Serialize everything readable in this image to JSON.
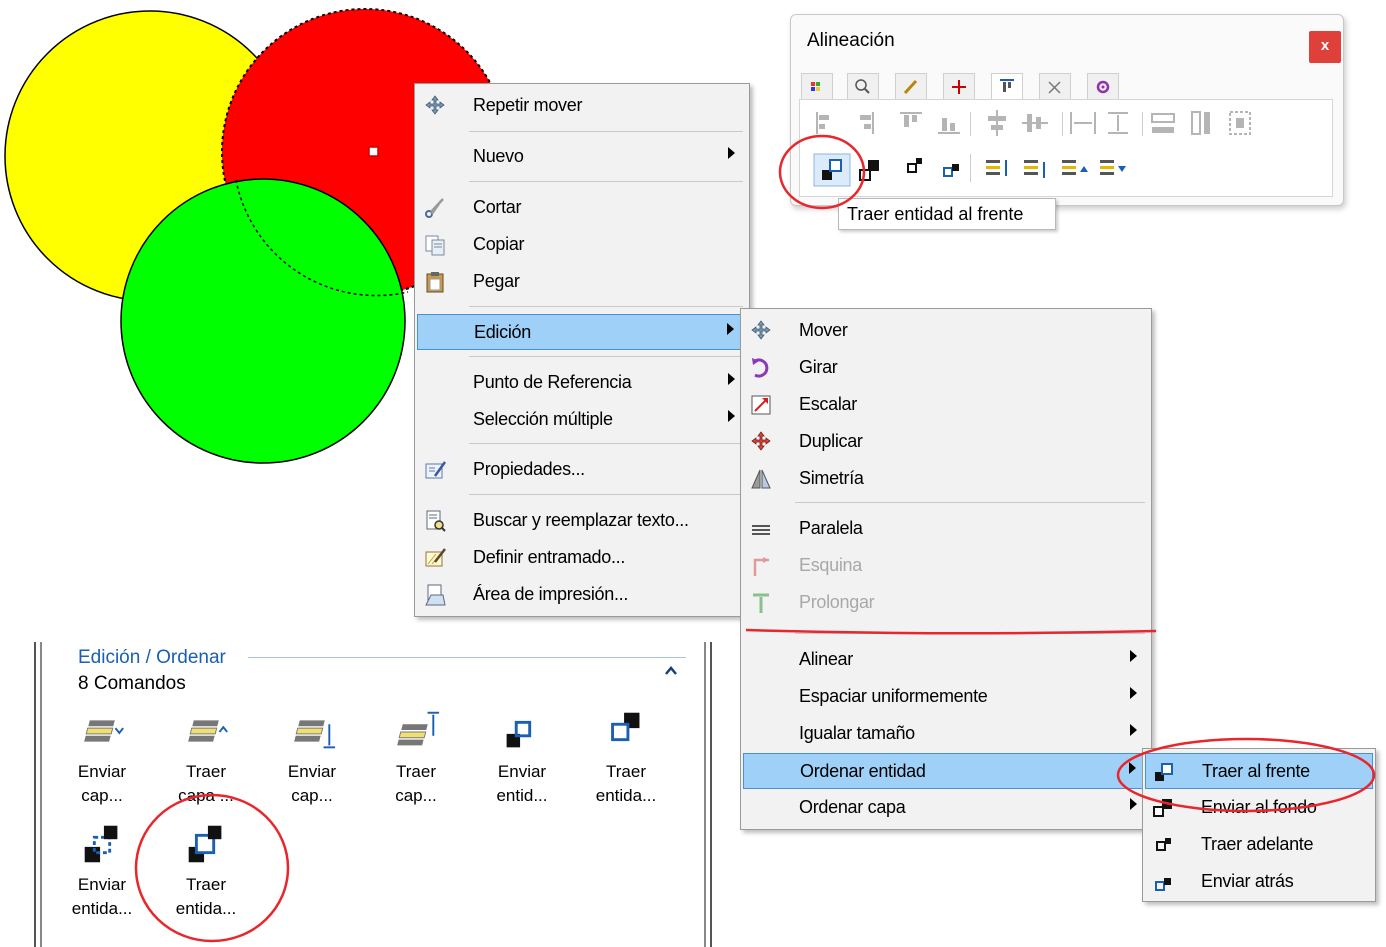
{
  "context_menu": {
    "items": [
      {
        "label": "Repetir mover",
        "icon": "move-icon",
        "submenu": false
      },
      {
        "label": "Nuevo",
        "icon": "",
        "submenu": true
      },
      {
        "label": "Cortar",
        "icon": "scissors-icon",
        "submenu": false
      },
      {
        "label": "Copiar",
        "icon": "copy-icon",
        "submenu": false
      },
      {
        "label": "Pegar",
        "icon": "paste-icon",
        "submenu": false
      },
      {
        "label": "Edición",
        "icon": "",
        "submenu": true,
        "highlighted": true
      },
      {
        "label": "Punto de Referencia",
        "icon": "",
        "submenu": true
      },
      {
        "label": "Selección múltiple",
        "icon": "",
        "submenu": true
      },
      {
        "label": "Propiedades...",
        "icon": "properties-icon",
        "submenu": false
      },
      {
        "label": "Buscar y reemplazar texto...",
        "icon": "find-replace-icon",
        "submenu": false
      },
      {
        "label": "Definir entramado...",
        "icon": "hatch-icon",
        "submenu": false
      },
      {
        "label": "Área de impresión...",
        "icon": "print-area-icon",
        "submenu": false
      }
    ]
  },
  "edit_submenu": {
    "items": [
      {
        "label": "Mover",
        "icon": "move-icon",
        "enabled": true,
        "submenu": false
      },
      {
        "label": "Girar",
        "icon": "rotate-icon",
        "enabled": true,
        "submenu": false
      },
      {
        "label": "Escalar",
        "icon": "scale-icon",
        "enabled": true,
        "submenu": false
      },
      {
        "label": "Duplicar",
        "icon": "duplicate-icon",
        "enabled": true,
        "submenu": false
      },
      {
        "label": "Simetría",
        "icon": "mirror-icon",
        "enabled": true,
        "submenu": false
      },
      {
        "label": "Paralela",
        "icon": "parallel-icon",
        "enabled": true,
        "submenu": false
      },
      {
        "label": "Esquina",
        "icon": "corner-icon",
        "enabled": false,
        "submenu": false
      },
      {
        "label": "Prolongar",
        "icon": "extend-icon",
        "enabled": false,
        "submenu": false
      },
      {
        "label": "Alinear",
        "icon": "",
        "enabled": true,
        "submenu": true
      },
      {
        "label": "Espaciar uniformemente",
        "icon": "",
        "enabled": true,
        "submenu": true
      },
      {
        "label": "Igualar tamaño",
        "icon": "",
        "enabled": true,
        "submenu": true
      },
      {
        "label": "Ordenar entidad",
        "icon": "",
        "enabled": true,
        "submenu": true,
        "highlighted": true
      },
      {
        "label": "Ordenar capa",
        "icon": "",
        "enabled": true,
        "submenu": true
      }
    ]
  },
  "order_submenu": {
    "items": [
      {
        "label": "Traer al frente",
        "icon": "bring-to-front-icon",
        "highlighted": true
      },
      {
        "label": "Enviar al fondo",
        "icon": "send-to-back-icon"
      },
      {
        "label": "Traer adelante",
        "icon": "bring-forward-icon"
      },
      {
        "label": "Enviar atrás",
        "icon": "send-backward-icon"
      }
    ]
  },
  "align_panel": {
    "title": "Alineación",
    "close_label": "x",
    "tooltip": "Traer entidad al frente"
  },
  "ribbon": {
    "group_title": "Edición / Ordenar",
    "count_label": "8 Comandos",
    "commands": [
      {
        "line1": "Enviar",
        "line2": "cap...",
        "icon": "send-layer-back-icon"
      },
      {
        "line1": "Traer",
        "line2": "capa ...",
        "icon": "bring-layer-front-icon"
      },
      {
        "line1": "Enviar",
        "line2": "cap...",
        "icon": "send-layer-bottom-icon"
      },
      {
        "line1": "Traer",
        "line2": "cap...",
        "icon": "bring-layer-top-icon"
      },
      {
        "line1": "Enviar",
        "line2": "entid...",
        "icon": "send-entity-back-icon"
      },
      {
        "line1": "Traer",
        "line2": "entida...",
        "icon": "bring-entity-front-icon"
      },
      {
        "line1": "Enviar",
        "line2": "entida...",
        "icon": "send-entity-backward-icon"
      },
      {
        "line1": "Traer",
        "line2": "entida...",
        "icon": "bring-entity-forward-icon"
      }
    ]
  },
  "colors": {
    "yellow_circle": "#ffff00",
    "red_circle": "#ff0000",
    "green_circle": "#00ff00",
    "highlight": "#9fd0f7",
    "annotation_red": "#e8262b",
    "ribbon_title": "#1a5fb4"
  }
}
